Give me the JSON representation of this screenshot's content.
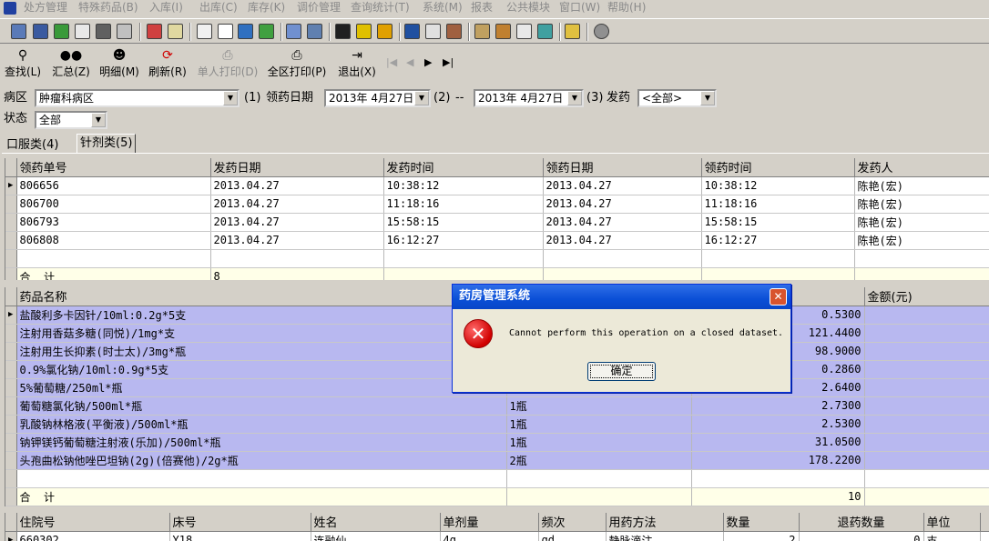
{
  "menu": {
    "items": [
      "处方管理",
      "特殊药品(B)",
      "入库(I)",
      "出库(C)",
      "库存(K)",
      "调价管理",
      "查询统计(T)",
      "系统(M)",
      "报表",
      "公共模块",
      "窗口(W)",
      "帮助(H)"
    ]
  },
  "actions": {
    "find": "查找(L)",
    "summary": "汇总(Z)",
    "detail": "明细(M)",
    "refresh": "刷新(R)",
    "print_single": "单人打印(D)",
    "print_all": "全区打印(P)",
    "exit": "退出(X)",
    "nav_first": "|◀",
    "nav_prev": "◀",
    "nav_next": "▶",
    "nav_last": "▶|"
  },
  "filters": {
    "ward_label": "病区",
    "ward_value": "肿瘤科病区",
    "step1": "(1)",
    "date_label": "领药日期",
    "date_from": "2013年 4月27日",
    "step2": "(2)",
    "dash": "--",
    "date_to": "2013年 4月27日",
    "step3": "(3)",
    "dispense_label": "发药",
    "dispense_value": "<全部>",
    "status_label": "状态",
    "status_value": "全部"
  },
  "tabs": [
    "口服类(4)",
    "针剂类(5)"
  ],
  "grid1": {
    "columns": [
      "领药单号",
      "发药日期",
      "发药时间",
      "领药日期",
      "领药时间",
      "发药人"
    ],
    "rows": [
      [
        "806656",
        "2013.04.27",
        "10:38:12",
        "2013.04.27",
        "10:38:12",
        "陈艳(宏)"
      ],
      [
        "806700",
        "2013.04.27",
        "11:18:16",
        "2013.04.27",
        "11:18:16",
        "陈艳(宏)"
      ],
      [
        "806793",
        "2013.04.27",
        "15:58:15",
        "2013.04.27",
        "15:58:15",
        "陈艳(宏)"
      ],
      [
        "806808",
        "2013.04.27",
        "16:12:27",
        "2013.04.27",
        "16:12:27",
        "陈艳(宏)"
      ]
    ],
    "total_label": "合  计",
    "total_value": "8"
  },
  "grid2": {
    "columns": [
      "药品名称",
      "",
      "",
      "金额(元)"
    ],
    "rows": [
      [
        "盐酸利多卡因针/10ml:0.2g*5支",
        "",
        "0.5300"
      ],
      [
        "注射用香菇多糖(同悦)/1mg*支",
        "",
        "121.4400"
      ],
      [
        "注射用生长抑素(时士太)/3mg*瓶",
        "",
        "98.9000"
      ],
      [
        "0.9%氯化钠/10ml:0.9g*5支",
        "",
        "0.2860"
      ],
      [
        "5%葡萄糖/250ml*瓶",
        "",
        "2.6400"
      ],
      [
        "葡萄糖氯化钠/500ml*瓶",
        "1瓶",
        "2.7300"
      ],
      [
        "乳酸钠林格液(平衡液)/500ml*瓶",
        "1瓶",
        "2.5300"
      ],
      [
        "钠钾镁钙葡萄糖注射液(乐加)/500ml*瓶",
        "1瓶",
        "31.0500"
      ],
      [
        "头孢曲松钠他唑巴坦钠(2g)(倍赛他)/2g*瓶",
        "2瓶",
        "178.2200"
      ]
    ],
    "total_label": "合  计",
    "total_value": "10"
  },
  "grid3": {
    "columns": [
      "住院号",
      "床号",
      "姓名",
      "单剂量",
      "频次",
      "用药方法",
      "数量",
      "退药数量",
      "单位"
    ],
    "rows": [
      [
        "660302",
        "Y18",
        "连融仙",
        "4g",
        "qd",
        "静脉滴注",
        "2",
        "0",
        "支"
      ]
    ]
  },
  "dialog": {
    "title": "药房管理系统",
    "close": "✕",
    "icon": "✕",
    "message": "Cannot perform this operation on a closed dataset.",
    "ok": "确定"
  },
  "colors": {
    "window_bg": "#d4d0c8",
    "drug_row_bg": "#b8b8f0",
    "total_row_bg": "#ffffe8",
    "dialog_title_bg": "#0a4fd6"
  }
}
